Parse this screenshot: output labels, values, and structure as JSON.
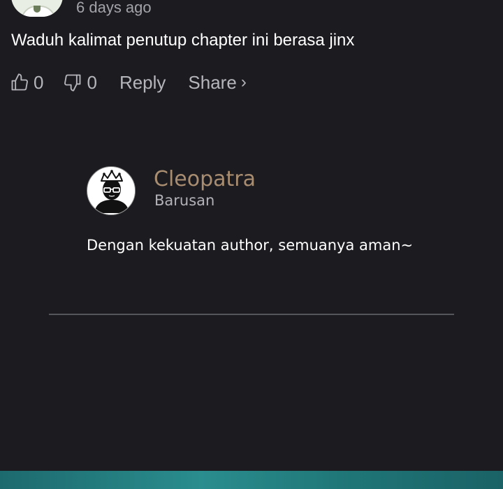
{
  "comment": {
    "timestamp": "6 days ago",
    "text": "Waduh kalimat penutup chapter ini berasa jinx",
    "actions": {
      "like_count": "0",
      "dislike_count": "0",
      "reply_label": "Reply",
      "share_label": "Share",
      "share_chevron": "›"
    },
    "icons": {
      "like": "thumbs-up-icon",
      "dislike": "thumbs-down-icon"
    }
  },
  "reply": {
    "author": "Cleopatra",
    "time": "Barusan",
    "text": "Dengan kekuatan author, semuanya aman~",
    "author_color": "#a88d71",
    "avatar_icon": "crowned-person-avatar-icon"
  },
  "colors": {
    "background": "#1c1b20",
    "muted_text": "#b5b5bc",
    "footer_teal": "#2a8d8e"
  }
}
